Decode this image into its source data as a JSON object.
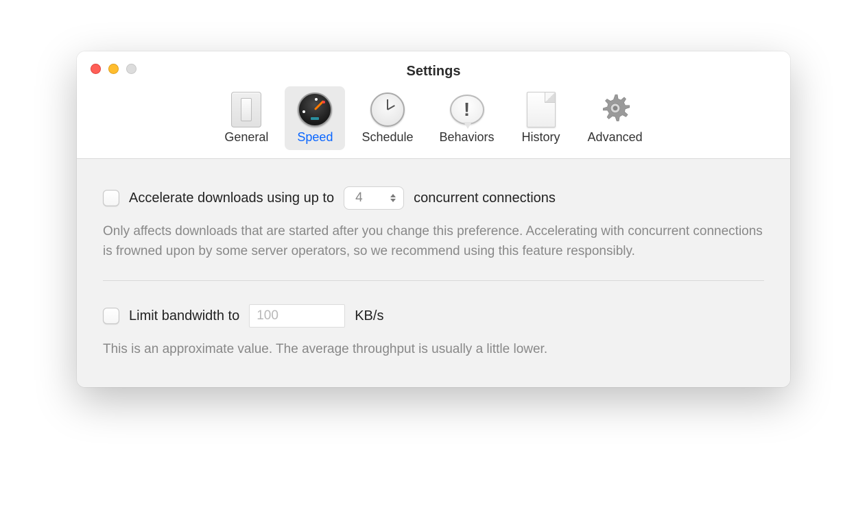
{
  "window": {
    "title": "Settings"
  },
  "tabs": [
    {
      "label": "General"
    },
    {
      "label": "Speed"
    },
    {
      "label": "Schedule"
    },
    {
      "label": "Behaviors"
    },
    {
      "label": "History"
    },
    {
      "label": "Advanced"
    }
  ],
  "accelerate": {
    "label_before": "Accelerate downloads using up to",
    "connections_value": "4",
    "label_after": "concurrent connections",
    "hint": "Only affects downloads that are started after you change this preference. Accelerating with concurrent connections is frowned upon by some server operators, so we recommend using this feature responsibly."
  },
  "bandwidth": {
    "label": "Limit bandwidth to",
    "placeholder": "100",
    "unit": "KB/s",
    "hint": "This is an approximate value. The average throughput is usually a little lower."
  }
}
